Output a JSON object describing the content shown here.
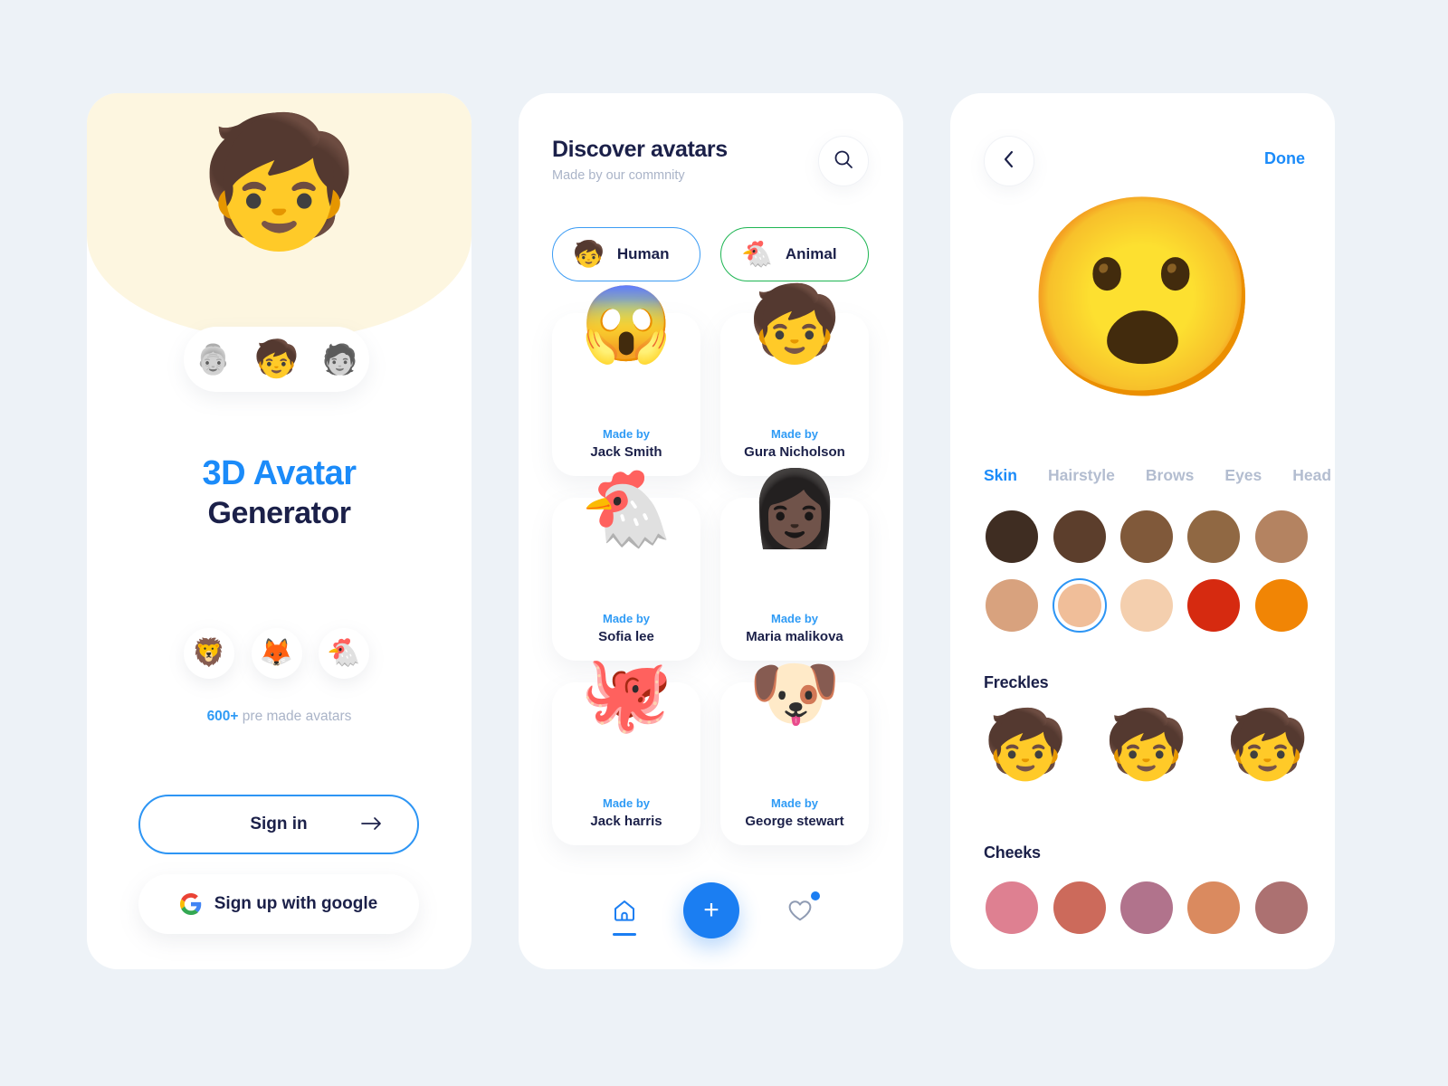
{
  "theme": {
    "page_bg": "#edf2f7",
    "panel_bg": "#ffffff",
    "accent_blue": "#1b7ef2",
    "link_blue": "#2f9bf5",
    "title_blue": "#1b8bf9",
    "dark_navy": "#1b2049",
    "muted": "#aab4c8",
    "cream": "#fdf6e0",
    "green": "#1eb553"
  },
  "onboarding": {
    "hero_avatar_icon": "boy-face-avatar",
    "hero_avatar_glyph": "🧒",
    "selector": [
      {
        "icon": "grandma-avatar",
        "glyph": "👵",
        "active": false
      },
      {
        "icon": "boy-avatar",
        "glyph": "🧒",
        "active": true
      },
      {
        "icon": "woman-avatar",
        "glyph": "🧑",
        "active": false
      }
    ],
    "title_line1": "3D Avatar",
    "title_line2": "Generator",
    "animals": [
      {
        "icon": "lion-avatar",
        "glyph": "🦁"
      },
      {
        "icon": "fox-avatar",
        "glyph": "🦊"
      },
      {
        "icon": "chicken-avatar",
        "glyph": "🐔"
      }
    ],
    "premade_count": "600+",
    "premade_text": " pre made avatars",
    "signin_label": "Sign in",
    "signin_arrow_icon": "arrow-right-icon",
    "google_label": "Sign up with google",
    "google_icon": "google-g-icon"
  },
  "discover": {
    "title": "Discover avatars",
    "subtitle": "Made by our commnity",
    "search_icon": "search-icon",
    "filters": [
      {
        "label": "Human",
        "icon": "human-avatar",
        "glyph": "🧒",
        "selected": true,
        "border": "#3c9cf4"
      },
      {
        "label": "Animal",
        "icon": "animal-avatar",
        "glyph": "🐔",
        "selected": false,
        "border": "#1eb553"
      }
    ],
    "made_by_label": "Made by",
    "cards": [
      {
        "glyph": "😱",
        "icon": "shocked-girl-avatar",
        "author": "Jack Smith"
      },
      {
        "glyph": "🧒",
        "icon": "boy-avatar",
        "author": "Gura Nicholson"
      },
      {
        "glyph": "🐔",
        "icon": "chicken-avatar",
        "author": "Sofia lee"
      },
      {
        "glyph": "👩🏿",
        "icon": "woman-avatar",
        "author": "Maria malikova"
      },
      {
        "glyph": "🐙",
        "icon": "octopus-avatar",
        "author": "Jack harris"
      },
      {
        "glyph": "🐶",
        "icon": "dog-avatar",
        "author": "George stewart"
      }
    ],
    "tabbar": {
      "home_icon": "home-icon",
      "add_icon": "plus-icon",
      "add_label": "+",
      "favorites_icon": "heart-icon",
      "has_notification": true
    }
  },
  "editor": {
    "back_icon": "chevron-left-icon",
    "done_label": "Done",
    "preview_icon": "boy-face-avatar",
    "preview_glyph": "😮",
    "tabs": [
      {
        "label": "Skin",
        "active": true
      },
      {
        "label": "Hairstyle",
        "active": false
      },
      {
        "label": "Brows",
        "active": false
      },
      {
        "label": "Eyes",
        "active": false
      },
      {
        "label": "Head",
        "active": false
      }
    ],
    "skin_swatches": [
      {
        "color": "#3f2d22",
        "selected": false
      },
      {
        "color": "#5c3e2c",
        "selected": false
      },
      {
        "color": "#80593a",
        "selected": false
      },
      {
        "color": "#906843",
        "selected": false
      },
      {
        "color": "#b48361",
        "selected": false
      },
      {
        "color": "#d8a27e",
        "selected": false
      },
      {
        "color": "#f0be99",
        "selected": true
      },
      {
        "color": "#f4cfae",
        "selected": false
      },
      {
        "color": "#d62a10",
        "selected": false
      },
      {
        "color": "#f18505",
        "selected": false
      }
    ],
    "freckles_title": "Freckles",
    "freckles": [
      {
        "icon": "freckles-none-avatar",
        "glyph": "🧒",
        "selected": false
      },
      {
        "icon": "freckles-light-avatar",
        "glyph": "🧒",
        "selected": false
      },
      {
        "icon": "freckles-heavy-avatar",
        "glyph": "🧒",
        "selected": false
      }
    ],
    "cheeks_title": "Cheeks",
    "cheeks": [
      {
        "color": "#de8091"
      },
      {
        "color": "#cc6a5b"
      },
      {
        "color": "#b1738c"
      },
      {
        "color": "#da8a5f"
      },
      {
        "color": "#ac7171"
      }
    ]
  }
}
